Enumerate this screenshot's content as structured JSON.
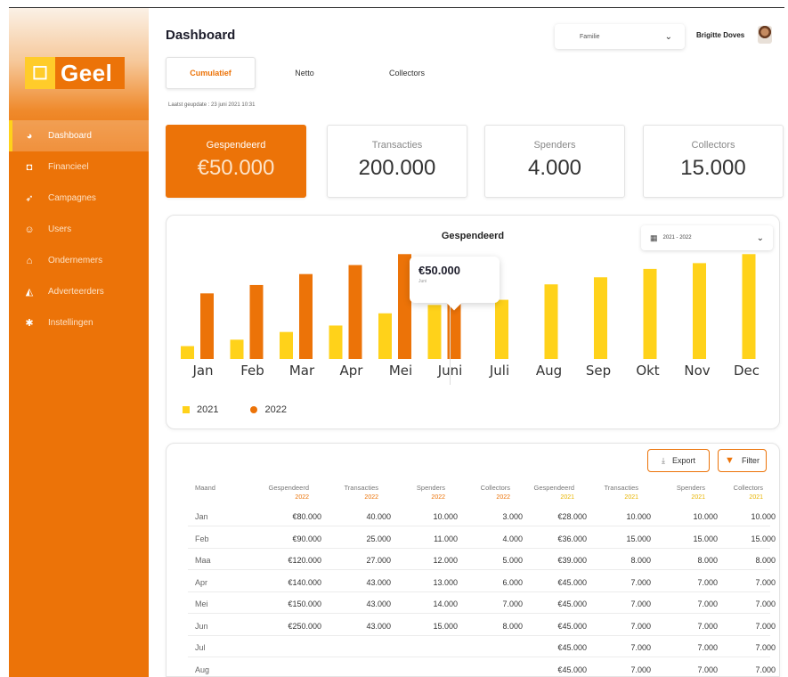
{
  "brand": {
    "name": "Geel",
    "mark": "☐"
  },
  "sidebar": {
    "items": [
      {
        "label": "Dashboard",
        "icon": "pie-chart-icon",
        "glyph": "◕",
        "active": true
      },
      {
        "label": "Financieel",
        "icon": "wallet-icon",
        "glyph": "◘",
        "active": false
      },
      {
        "label": "Campagnes",
        "icon": "rocket-icon",
        "glyph": "➶",
        "active": false
      },
      {
        "label": "Users",
        "icon": "smiley-icon",
        "glyph": "☺",
        "active": false
      },
      {
        "label": "Ondernemers",
        "icon": "shop-icon",
        "glyph": "⌂",
        "active": false
      },
      {
        "label": "Adverteerders",
        "icon": "megaphone-icon",
        "glyph": "◭",
        "active": false
      },
      {
        "label": "Instellingen",
        "icon": "gear-icon",
        "glyph": "✱",
        "active": false
      }
    ]
  },
  "header": {
    "title": "Dashboard",
    "select_value": "Familie",
    "user_name": "Brigitte Doves"
  },
  "tabs": [
    {
      "label": "Cumulatief",
      "active": true
    },
    {
      "label": "Netto",
      "active": false
    },
    {
      "label": "Collectors",
      "active": false
    }
  ],
  "last_update": "Laatst geupdate : 23 juni 2021 10:31",
  "kpis": [
    {
      "label": "Gespendeerd",
      "value": "€50.000",
      "primary": true
    },
    {
      "label": "Transacties",
      "value": "200.000",
      "primary": false
    },
    {
      "label": "Spenders",
      "value": "4.000",
      "primary": false
    },
    {
      "label": "Collectors",
      "value": "15.000",
      "primary": false
    }
  ],
  "chart_data": {
    "type": "bar",
    "title": "Gespendeerd",
    "date_range": "2021 - 2022",
    "categories": [
      "Jan",
      "Feb",
      "Mar",
      "Apr",
      "Mei",
      "Juni",
      "Juli",
      "Aug",
      "Sep",
      "Okt",
      "Nov",
      "Dec"
    ],
    "series": [
      {
        "name": "2021",
        "color": "#ffd21a",
        "values": [
          2,
          3,
          4.2,
          5.2,
          7.1,
          8.4,
          9.2,
          11.6,
          12.7,
          14,
          14.9,
          16.3
        ]
      },
      {
        "name": "2022",
        "color": "#ec7308",
        "values": [
          10.2,
          11.5,
          13.2,
          14.6,
          16.3,
          8.8,
          null,
          null,
          null,
          null,
          null,
          null
        ]
      }
    ],
    "ylim": [
      0,
      18
    ],
    "legend": "bottom-left",
    "tooltip": {
      "value": "€50.000",
      "month": "Juni"
    }
  },
  "table": {
    "export_label": "Export",
    "filter_label": "Filter",
    "columns": [
      {
        "label": "Maand",
        "year": ""
      },
      {
        "label": "Gespendeerd",
        "year": "2022"
      },
      {
        "label": "Transacties",
        "year": "2022"
      },
      {
        "label": "Spenders",
        "year": "2022"
      },
      {
        "label": "Collectors",
        "year": "2022"
      },
      {
        "label": "Gespendeerd",
        "year": "2021"
      },
      {
        "label": "Transacties",
        "year": "2021"
      },
      {
        "label": "Spenders",
        "year": "2021"
      },
      {
        "label": "Collectors",
        "year": "2021"
      }
    ],
    "rows": [
      [
        "Jan",
        "€80.000",
        "40.000",
        "10.000",
        "3.000",
        "€28.000",
        "10.000",
        "10.000",
        "10.000"
      ],
      [
        "Feb",
        "€90.000",
        "25.000",
        "11.000",
        "4.000",
        "€36.000",
        "15.000",
        "15.000",
        "15.000"
      ],
      [
        "Maa",
        "€120.000",
        "27.000",
        "12.000",
        "5.000",
        "€39.000",
        "8.000",
        "8.000",
        "8.000"
      ],
      [
        "Apr",
        "€140.000",
        "43.000",
        "13.000",
        "6.000",
        "€45.000",
        "7.000",
        "7.000",
        "7.000"
      ],
      [
        "Mei",
        "€150.000",
        "43.000",
        "14.000",
        "7.000",
        "€45.000",
        "7.000",
        "7.000",
        "7.000"
      ],
      [
        "Jun",
        "€250.000",
        "43.000",
        "15.000",
        "8.000",
        "€45.000",
        "7.000",
        "7.000",
        "7.000"
      ],
      [
        "Jul",
        "",
        "",
        "",
        "",
        "€45.000",
        "7.000",
        "7.000",
        "7.000"
      ],
      [
        "Aug",
        "",
        "",
        "",
        "",
        "€45.000",
        "7.000",
        "7.000",
        "7.000"
      ]
    ]
  }
}
